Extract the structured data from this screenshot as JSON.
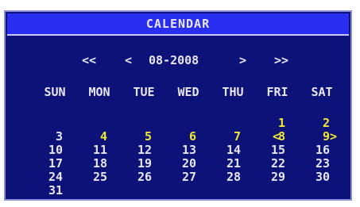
{
  "window": {
    "title": "CALENDAR"
  },
  "nav": {
    "prev_year": "<<",
    "prev_month": "<",
    "month_label": "08-2008",
    "next_month": ">",
    "next_year": ">>"
  },
  "weekdays": [
    "SUN",
    "MON",
    "TUE",
    "WED",
    "THU",
    "FRI",
    "SAT"
  ],
  "days": [
    {
      "label": "1",
      "col": 5,
      "row": 0,
      "record": true
    },
    {
      "label": "2",
      "col": 6,
      "row": 0,
      "record": true
    },
    {
      "label": "3",
      "col": 0,
      "row": 1,
      "record": false
    },
    {
      "label": "4",
      "col": 1,
      "row": 1,
      "record": true
    },
    {
      "label": "5",
      "col": 2,
      "row": 1,
      "record": true
    },
    {
      "label": "6",
      "col": 3,
      "row": 1,
      "record": true
    },
    {
      "label": "7",
      "col": 4,
      "row": 1,
      "record": true
    },
    {
      "label": "8",
      "col": 5,
      "row": 1,
      "record": true
    },
    {
      "label": "9",
      "col": 6,
      "row": 1,
      "record": true,
      "selected": true
    },
    {
      "label": "10",
      "col": 0,
      "row": 2,
      "record": false
    },
    {
      "label": "11",
      "col": 1,
      "row": 2,
      "record": false
    },
    {
      "label": "12",
      "col": 2,
      "row": 2,
      "record": false
    },
    {
      "label": "13",
      "col": 3,
      "row": 2,
      "record": false
    },
    {
      "label": "14",
      "col": 4,
      "row": 2,
      "record": false
    },
    {
      "label": "15",
      "col": 5,
      "row": 2,
      "record": false
    },
    {
      "label": "16",
      "col": 6,
      "row": 2,
      "record": false
    },
    {
      "label": "17",
      "col": 0,
      "row": 3,
      "record": false
    },
    {
      "label": "18",
      "col": 1,
      "row": 3,
      "record": false
    },
    {
      "label": "19",
      "col": 2,
      "row": 3,
      "record": false
    },
    {
      "label": "20",
      "col": 3,
      "row": 3,
      "record": false
    },
    {
      "label": "21",
      "col": 4,
      "row": 3,
      "record": false
    },
    {
      "label": "22",
      "col": 5,
      "row": 3,
      "record": false
    },
    {
      "label": "23",
      "col": 6,
      "row": 3,
      "record": false
    },
    {
      "label": "24",
      "col": 0,
      "row": 4,
      "record": false
    },
    {
      "label": "25",
      "col": 1,
      "row": 4,
      "record": false
    },
    {
      "label": "26",
      "col": 2,
      "row": 4,
      "record": false
    },
    {
      "label": "27",
      "col": 3,
      "row": 4,
      "record": false
    },
    {
      "label": "28",
      "col": 4,
      "row": 4,
      "record": false
    },
    {
      "label": "29",
      "col": 5,
      "row": 4,
      "record": false
    },
    {
      "label": "30",
      "col": 6,
      "row": 4,
      "record": false
    },
    {
      "label": "31",
      "col": 0,
      "row": 5,
      "record": false
    }
  ],
  "selection": {
    "left_marker": "<",
    "right_marker": ">"
  },
  "colors": {
    "panel": "#0c1278",
    "title_bar": "#2a2ef0",
    "text": "#e6e6f0",
    "record_day": "#f0e832"
  }
}
